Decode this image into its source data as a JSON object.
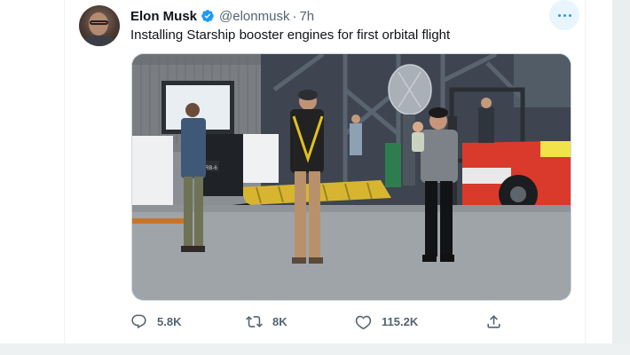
{
  "tweet": {
    "author_name": "Elon Musk",
    "handle": "@elonmusk",
    "separator": "·",
    "time": "7h",
    "text": "Installing Starship booster engines for first orbital flight",
    "verified": true
  },
  "media": {
    "description_icon": "photo",
    "sign_label": "PRB-6"
  },
  "actions": {
    "replies": "5.8K",
    "retweets": "8K",
    "likes": "115.2K"
  },
  "colors": {
    "accent": "#1d9bf0",
    "text_secondary": "#536471",
    "forklift": "#d93a2b"
  },
  "icons": {
    "more": "more-horizontal-icon",
    "reply": "reply-icon",
    "retweet": "retweet-icon",
    "like": "heart-icon",
    "share": "share-icon",
    "verified": "verified-badge-icon"
  }
}
